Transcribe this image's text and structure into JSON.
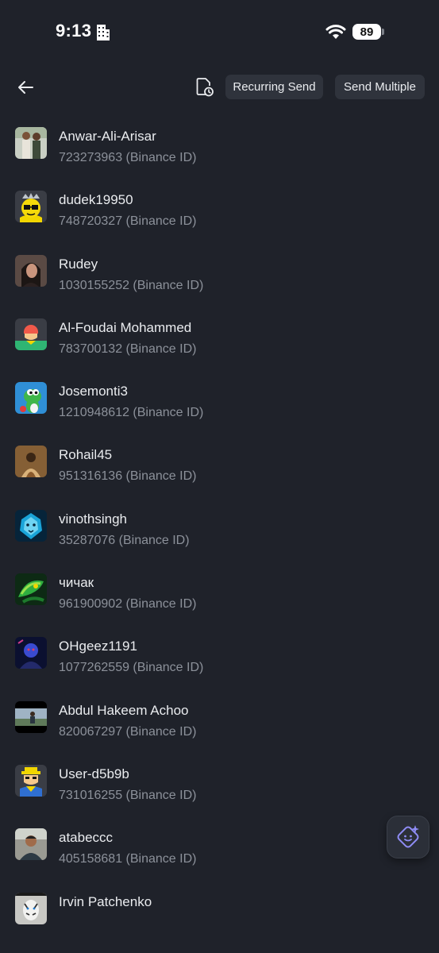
{
  "status_bar": {
    "time": "9:13",
    "battery": "89"
  },
  "top_bar": {
    "recurring_send_label": "Recurring Send",
    "send_multiple_label": "Send Multiple",
    "back_icon": "arrow-left-icon",
    "history_icon": "document-clock-icon"
  },
  "contacts": [
    {
      "name": "Anwar-Ali-Arisar",
      "id": "723273963 (Binance ID)"
    },
    {
      "name": "dudek19950",
      "id": "748720327 (Binance ID)"
    },
    {
      "name": "Rudey",
      "id": "1030155252 (Binance ID)"
    },
    {
      "name": "Al-Foudai Mohammed",
      "id": "783700132 (Binance ID)"
    },
    {
      "name": "Josemonti3",
      "id": "1210948612 (Binance ID)"
    },
    {
      "name": "Rohail45",
      "id": "951316136 (Binance ID)"
    },
    {
      "name": "vinothsingh",
      "id": "35287076 (Binance ID)"
    },
    {
      "name": "чичак",
      "id": "961900902 (Binance ID)"
    },
    {
      "name": "OHgeez1191",
      "id": "1077262559 (Binance ID)"
    },
    {
      "name": "Abdul Hakeem Achoo",
      "id": "820067297 (Binance ID)"
    },
    {
      "name": "User-d5b9b",
      "id": "731016255 (Binance ID)"
    },
    {
      "name": "atabeccc",
      "id": "405158681 (Binance ID)"
    },
    {
      "name": "Irvin Patchenko",
      "id": ""
    }
  ],
  "colors": {
    "background": "#1f222a",
    "pill_background": "#2f333c",
    "secondary_text": "#8c919a",
    "assistant_accent": "#8f8cf5"
  }
}
